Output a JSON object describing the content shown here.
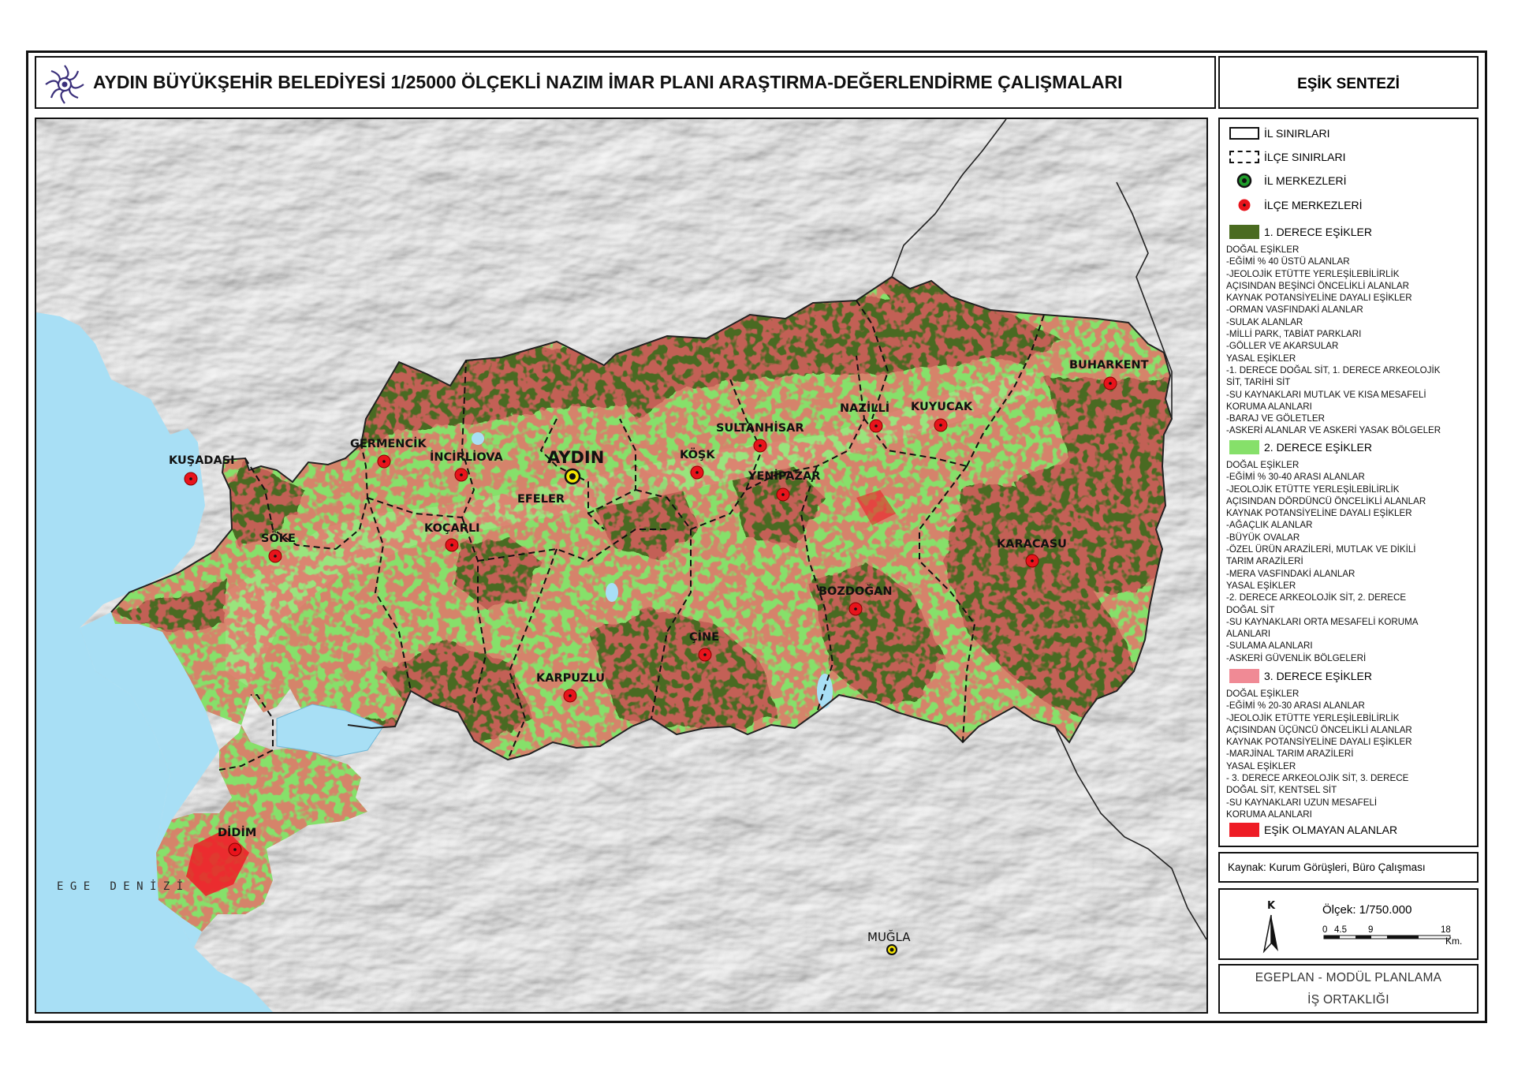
{
  "header": {
    "title": "AYDIN BÜYÜKŞEHİR BELEDİYESİ 1/25000 ÖLÇEKLİ NAZIM İMAR PLANI ARAŞTIRMA-DEĞERLENDİRME ÇALIŞMALARI",
    "panel_title": "EŞİK SENTEZİ"
  },
  "colors": {
    "first_degree": "#4a6b20",
    "second_degree": "#86e06a",
    "third_degree": "#f08a95",
    "no_threshold": "#ee1c25",
    "water": "#a8dff5",
    "district_center": "#e8131b",
    "province_center_ring": "#f4e400"
  },
  "legend": {
    "il_sinirlari": "İL SINIRLARI",
    "ilce_sinirlari": "İLÇE SINIRLARI",
    "il_merkezleri": "İL MERKEZLERİ",
    "ilce_merkezleri": "İLÇE MERKEZLERİ",
    "first": {
      "label": "1. DERECE EŞİKLER",
      "desc": "DOĞAL EŞİKLER\n-EĞİMİ % 40 ÜSTÜ ALANLAR\n-JEOLOJİK ETÜTTE YERLEŞİLEBİLİRLİK\nAÇISINDAN BEŞİNCİ ÖNCELİKLİ ALANLAR\nKAYNAK POTANSİYELİNE DAYALI EŞİKLER\n-ORMAN VASFINDAKİ ALANLAR\n-SULAK ALANLAR\n-MİLLİ PARK, TABİAT PARKLARI\n-GÖLLER VE AKARSULAR\nYASAL EŞİKLER\n-1. DERECE DOĞAL SİT, 1. DERECE ARKEOLOJİK\nSİT, TARİHİ SİT\n-SU KAYNAKLARI MUTLAK VE KISA MESAFELİ\nKORUMA ALANLARI\n-BARAJ VE GÖLETLER\n-ASKERİ ALANLAR VE ASKERİ YASAK BÖLGELER"
    },
    "second": {
      "label": "2. DERECE EŞİKLER",
      "desc": "DOĞAL EŞİKLER\n-EĞİMİ % 30-40 ARASI ALANLAR\n-JEOLOJİK ETÜTTE YERLEŞİLEBİLİRLİK\nAÇISINDAN DÖRDÜNCÜ ÖNCELİKLİ ALANLAR\nKAYNAK POTANSİYELİNE DAYALI EŞİKLER\n-AĞAÇLIK ALANLAR\n-BÜYÜK OVALAR\n-ÖZEL ÜRÜN ARAZİLERİ, MUTLAK VE DİKİLİ\nTARIM ARAZİLERİ\n-MERA VASFINDAKİ ALANLAR\nYASAL EŞİKLER\n-2. DERECE ARKEOLOJİK SİT, 2. DERECE\nDOĞAL SİT\n-SU KAYNAKLARI ORTA MESAFELİ KORUMA\nALANLARI\n-SULAMA ALANLARI\n-ASKERİ GÜVENLİK BÖLGELERİ"
    },
    "third": {
      "label": "3. DERECE EŞİKLER",
      "desc": "DOĞAL EŞİKLER\n-EĞİMİ % 20-30 ARASI ALANLAR\n-JEOLOJİK ETÜTTE YERLEŞİLEBİLİRLİK\nAÇISINDAN ÜÇÜNCÜ ÖNCELİKLİ ALANLAR\nKAYNAK POTANSİYELİNE DAYALI EŞİKLER\n-MARJİNAL TARIM ARAZİLERİ\nYASAL EŞİKLER\n- 3. DERECE ARKEOLOJİK SİT, 3. DERECE\nDOĞAL SİT, KENTSEL SİT\n-SU KAYNAKLARI UZUN MESAFELİ\nKORUMA ALANLARI"
    },
    "none": {
      "label": "EŞİK OLMAYAN ALANLAR"
    }
  },
  "source": "Kaynak: Kurum Görüşleri, Büro Çalışması",
  "scale": {
    "north": "K",
    "label": "Ölçek: 1/750.000",
    "ticks": [
      "0",
      "4.5",
      "9",
      "18"
    ],
    "unit": "Km."
  },
  "footer": {
    "line1": "EGEPLAN - MODÜL PLANLAMA",
    "line2": "İŞ ORTAKLIĞI"
  },
  "map": {
    "sea_label": "E G E   D E N İ Z İ",
    "province_center": "AYDIN",
    "neighbor_center": "MUĞLA",
    "districts": [
      "KUŞADASI",
      "SÖKE",
      "GERMENCİK",
      "İNCİRLİOVA",
      "EFELER",
      "KOÇARLI",
      "KÖŞK",
      "SULTANHİSAR",
      "YENİPAZAR",
      "NAZİLLİ",
      "KUYUCAK",
      "BUHARKENT",
      "KARACASU",
      "BOZDOĞAN",
      "ÇİNE",
      "KARPUZLU",
      "DİDİM"
    ]
  }
}
